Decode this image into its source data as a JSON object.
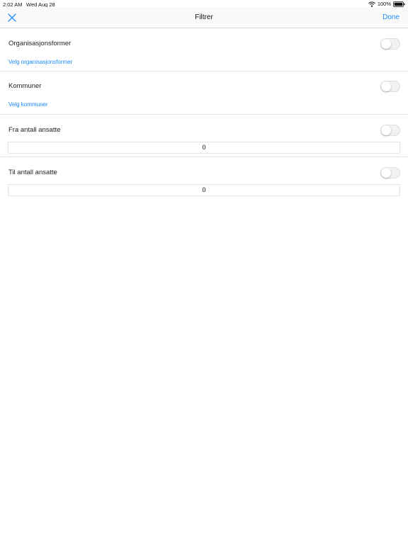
{
  "status_bar": {
    "time": "2:02 AM",
    "date": "Wed Aug 28",
    "battery": "100%"
  },
  "nav": {
    "title": "Filtrer",
    "done_label": "Done",
    "close_icon": "close-x-icon"
  },
  "sections": {
    "org_forms": {
      "label": "Organisasjonsformer",
      "link": "Velg organisasjonsformer",
      "enabled": false
    },
    "municipalities": {
      "label": "Kommuner",
      "link": "Velg kommuner",
      "enabled": false
    },
    "from_employees": {
      "label": "Fra antall ansatte",
      "value": "0",
      "enabled": false
    },
    "to_employees": {
      "label": "Til antall ansatte",
      "value": "0",
      "enabled": false
    }
  },
  "colors": {
    "accent": "#1a8cff",
    "divider": "#e2e2e5"
  }
}
